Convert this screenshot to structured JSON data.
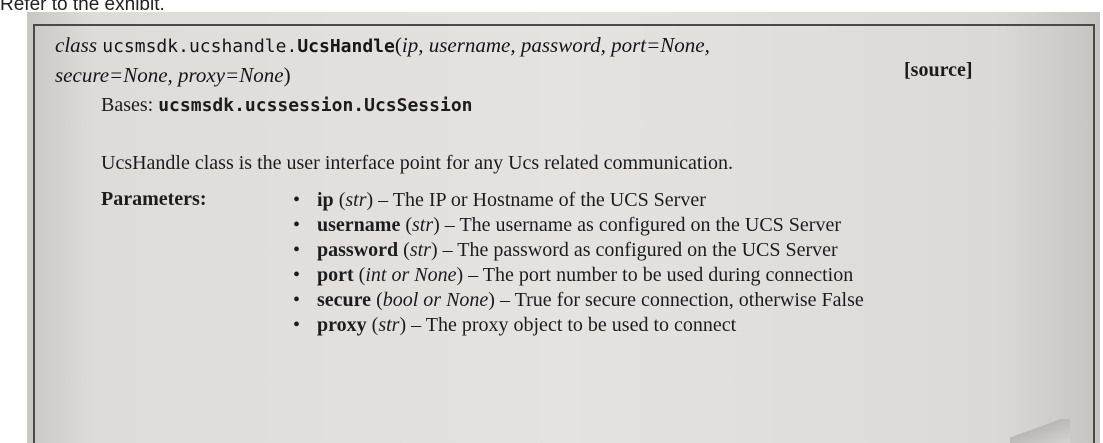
{
  "caption": "Refer to the exhibit.",
  "signature": {
    "prefix": "class",
    "module": "ucsmsdk.ucshandle.",
    "class_name": "UcsHandle",
    "open_paren": "(",
    "args_line1": "ip, username, password, port=None,",
    "args_line2": "secure=None, proxy=None",
    "close_paren": ")",
    "source_link": "[source]"
  },
  "bases": {
    "label": "Bases:",
    "value": "ucsmsdk.ucssession.UcsSession"
  },
  "description": "UcsHandle class is the user interface point for any Ucs related communication.",
  "parameters": {
    "label": "Parameters:",
    "items": [
      {
        "name": "ip",
        "type": "str",
        "desc": "The IP or Hostname of the UCS Server"
      },
      {
        "name": "username",
        "type": "str",
        "desc": "The username as configured on the UCS Server"
      },
      {
        "name": "password",
        "type": "str",
        "desc": "The password as configured on the UCS Server"
      },
      {
        "name": "port",
        "type": "int or None",
        "desc": "The port number to be used during connection"
      },
      {
        "name": "secure",
        "type": "bool or None",
        "desc": "True for secure connection, otherwise False"
      },
      {
        "name": "proxy",
        "type": "str",
        "desc": "The proxy object to be used to connect"
      }
    ]
  }
}
